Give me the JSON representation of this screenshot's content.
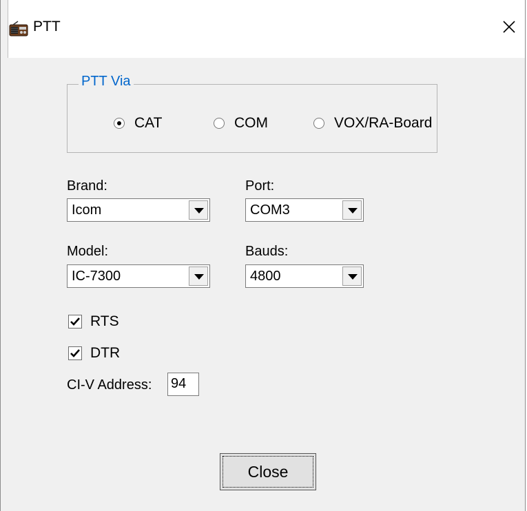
{
  "window": {
    "title": "PTT",
    "close_glyph": "✕",
    "app_icon": "radio-icon"
  },
  "ptt_via": {
    "legend": "PTT Via",
    "options": [
      {
        "label": "CAT",
        "selected": true
      },
      {
        "label": "COM",
        "selected": false
      },
      {
        "label": "VOX/RA-Board",
        "selected": false
      }
    ]
  },
  "brand": {
    "label": "Brand:",
    "value": "Icom"
  },
  "port": {
    "label": "Port:",
    "value": "COM3"
  },
  "model": {
    "label": "Model:",
    "value": "IC-7300"
  },
  "bauds": {
    "label": "Bauds:",
    "value": "4800"
  },
  "rts": {
    "label": "RTS",
    "checked": true
  },
  "dtr": {
    "label": "DTR",
    "checked": true
  },
  "civ": {
    "label": "CI-V Address:",
    "value": "94"
  },
  "close_button": {
    "label": "Close"
  },
  "colors": {
    "legend": "#0066cc",
    "background": "#f0f0f0"
  }
}
